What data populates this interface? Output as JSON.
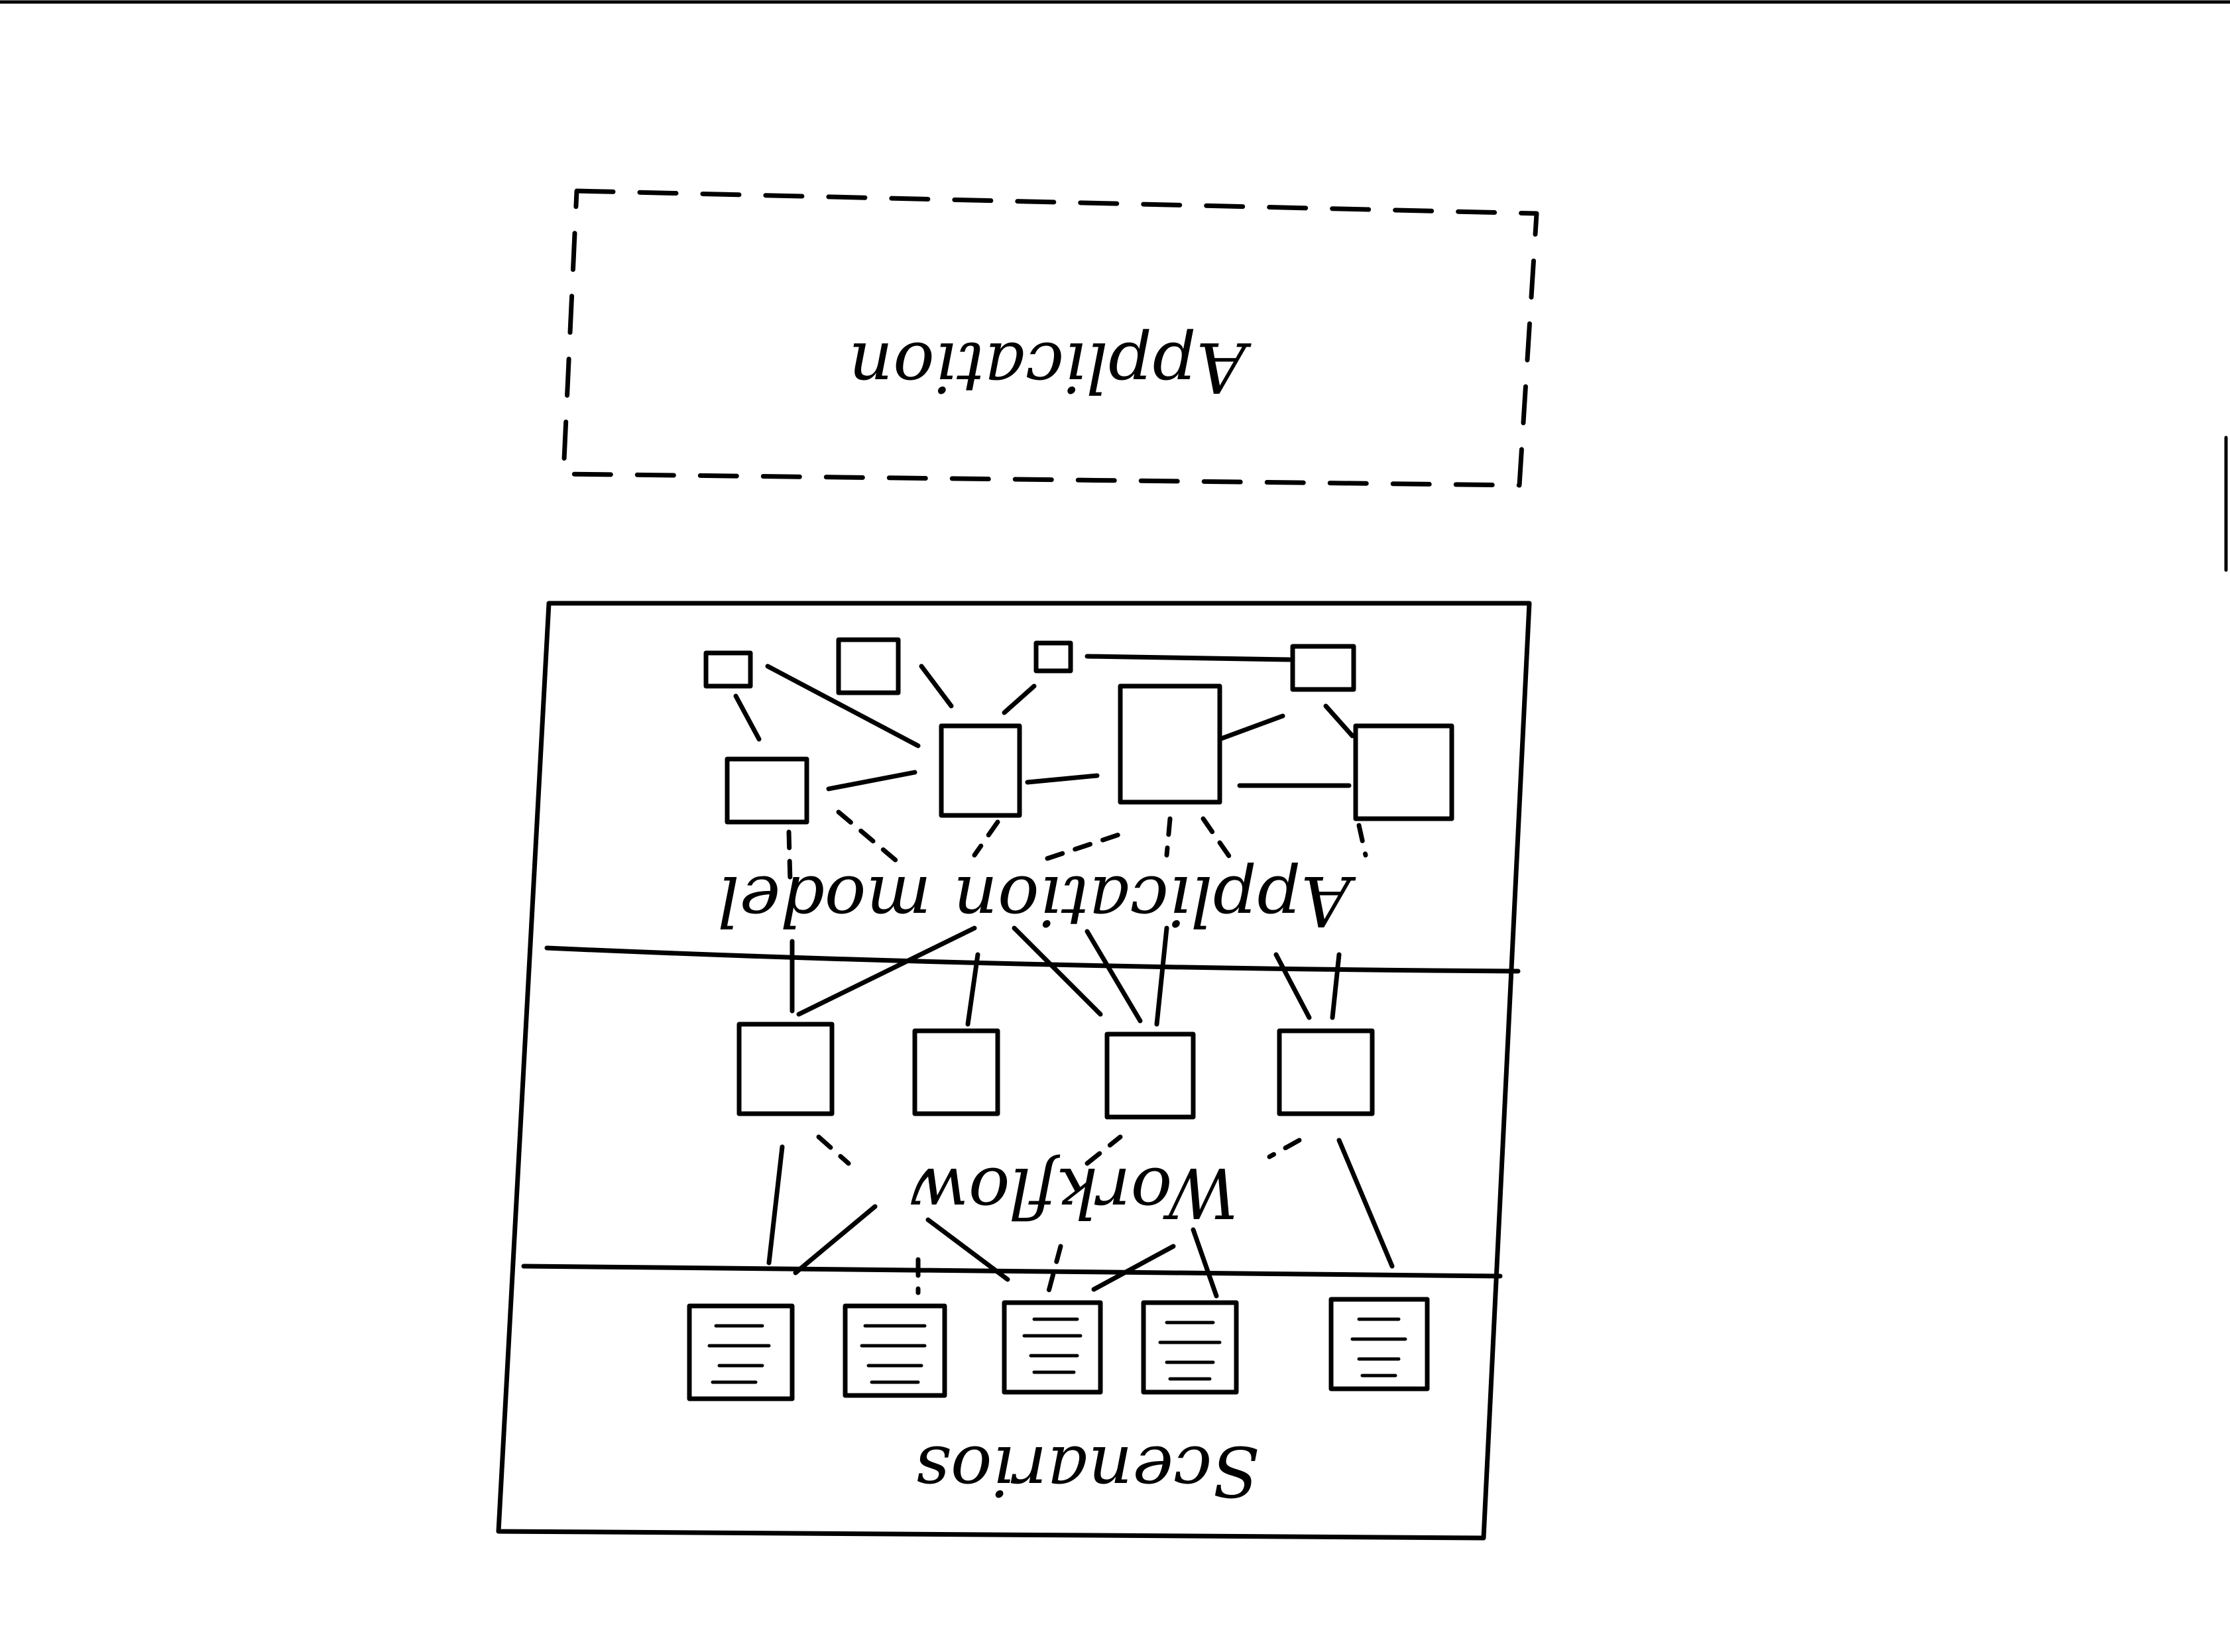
{
  "diagram": {
    "orientation": "upside-down",
    "application_label": "Application",
    "layers": [
      {
        "id": "application-model",
        "label": "Application model"
      },
      {
        "id": "workflow",
        "label": "Workflow"
      },
      {
        "id": "scenarios",
        "label": "Scenarios"
      }
    ],
    "ink_color": "#000000",
    "background_color": "#ffffff"
  }
}
